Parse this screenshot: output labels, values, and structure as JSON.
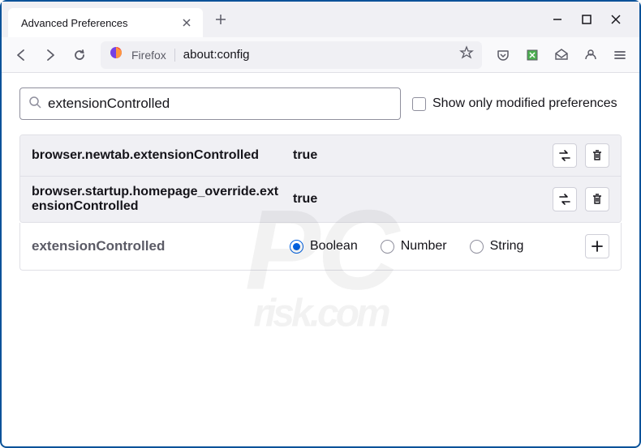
{
  "window": {
    "tab_title": "Advanced Preferences"
  },
  "urlbar": {
    "identity": "Firefox",
    "url": "about:config"
  },
  "search": {
    "value": "extensionControlled",
    "checkbox_label": "Show only modified preferences"
  },
  "prefs": [
    {
      "name": "browser.newtab.extensionControlled",
      "value": "true"
    },
    {
      "name": "browser.startup.homepage_override.extensionControlled",
      "value": "true"
    }
  ],
  "add": {
    "name": "extensionControlled",
    "types": {
      "boolean": "Boolean",
      "number": "Number",
      "string": "String"
    },
    "selected": "boolean"
  },
  "watermark": {
    "main": "PC",
    "sub": "risk.com"
  }
}
